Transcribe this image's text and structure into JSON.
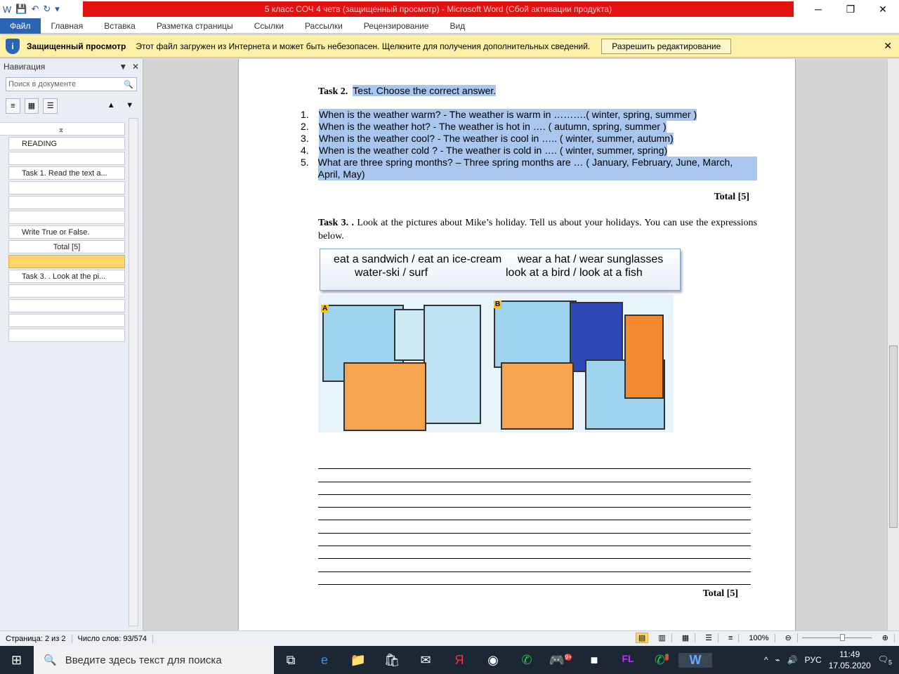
{
  "window": {
    "title": "5 класс СОЧ 4 четв (защищенный просмотр)  -  Microsoft Word (Сбой активации продукта)"
  },
  "ribbon": {
    "tabs": [
      "Файл",
      "Главная",
      "Вставка",
      "Разметка страницы",
      "Ссылки",
      "Рассылки",
      "Рецензирование",
      "Вид"
    ]
  },
  "protected": {
    "title": "Защищенный просмотр",
    "message": "Этот файл загружен из Интернета и может быть небезопасен. Щелкните для получения дополнительных сведений.",
    "button": "Разрешить редактирование"
  },
  "nav": {
    "title": "Навигация",
    "search_placeholder": "Поиск в документе",
    "headings": [
      "",
      "READING",
      "",
      "Task 1. Read the text a...",
      "",
      "",
      "",
      "Write True or False.",
      "Total [5]",
      "",
      "Task 3. . Look at the pi...",
      "",
      "",
      "",
      ""
    ]
  },
  "doc": {
    "task2_label": "Task 2.",
    "task2_text": "Test. Choose the correct answer.",
    "items": [
      "When is the weather warm? - The weather is warm in ……….( winter, spring, summer )",
      "When is the weather hot? - The weather is hot in …. ( autumn, spring, summer )",
      "When is the weather cool? - The weather is cool in ….. ( winter, summer, autumn)",
      "When is the weather cold ? - The weather is cold in …. ( winter, summer, spring)",
      "What are three spring months? – Three spring months are … ( January, February, June, March, April, May)"
    ],
    "total1": "Total [5]",
    "task3_label": "Task 3. .",
    "task3_text": "Look at the pictures about Mike’s holiday. Tell us about your holidays. You can use the expressions below.",
    "expressions": [
      "eat a sandwich / eat an ice-cream",
      "wear a hat / wear sunglasses",
      "water-ski / surf",
      "look at a bird / look at a fish"
    ],
    "pic_labels": [
      "A",
      "B"
    ],
    "total2": "Total [5]"
  },
  "status": {
    "page": "Страница: 2 из 2",
    "words": "Число слов: 93/574",
    "zoom": "100%"
  },
  "taskbar": {
    "search": "Введите здесь текст для поиска",
    "lang": "РУС",
    "time": "11:49",
    "date": "17.05.2020",
    "badges": [
      "9+",
      "7"
    ],
    "notifications": "5"
  }
}
